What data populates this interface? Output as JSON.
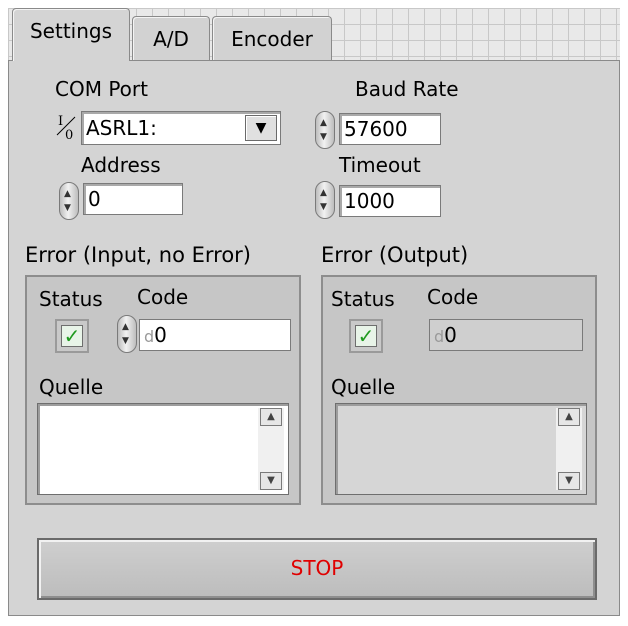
{
  "tabs": [
    {
      "label": "Settings",
      "active": true
    },
    {
      "label": "A/D",
      "active": false
    },
    {
      "label": "Encoder",
      "active": false
    }
  ],
  "settings": {
    "com_port": {
      "label": "COM Port",
      "io_badge": "I/O",
      "value": "ASRL1:"
    },
    "baud_rate": {
      "label": "Baud Rate",
      "value": "57600"
    },
    "address": {
      "label": "Address",
      "value": "0"
    },
    "timeout": {
      "label": "Timeout",
      "value": "1000"
    }
  },
  "error_in": {
    "title": "Error (Input, no Error)",
    "status_label": "Status",
    "code_label": "Code",
    "code_prefix": "d",
    "code_value": "0",
    "source_label": "Quelle",
    "source_value": ""
  },
  "error_out": {
    "title": "Error (Output)",
    "status_label": "Status",
    "code_label": "Code",
    "code_prefix": "d",
    "code_value": "0",
    "source_label": "Quelle",
    "source_value": ""
  },
  "stop_button": {
    "label": "STOP"
  },
  "colors": {
    "stop_text": "#e00000",
    "status_ok": "#1f9a1f",
    "panel": "#d4d4d4"
  },
  "icons": {
    "status": "checkmark-icon",
    "spin": "spin-arrows-icon",
    "dropdown": "down-arrow-icon"
  }
}
